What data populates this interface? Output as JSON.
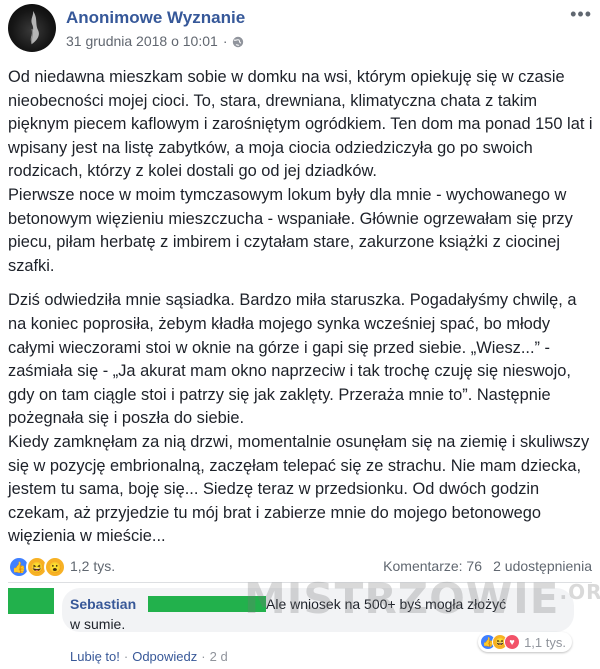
{
  "post": {
    "page_name": "Anonimowe Wyznanie",
    "date": "31 grudnia 2018 o 10:01",
    "separator": "·",
    "more_icon": "more-dots-icon",
    "paragraphs": [
      "Od niedawna mieszkam sobie w domku na wsi, którym opiekuję się w czasie nieobecności mojej cioci. To, stara, drewniana, klimatyczna chata z takim pięknym piecem kaflowym i zarośniętym ogródkiem. Ten dom ma ponad 150 lat i wpisany jest na listę zabytków, a moja ciocia odziedziczyła go po swoich rodzicach, którzy z kolei dostali go od jej dziadków.\nPierwsze noce w moim tymczasowym lokum były dla mnie - wychowanego w betonowym więzieniu mieszczucha - wspaniałe. Głównie ogrzewałam się przy piecu, piłam herbatę z imbirem i czytałam stare, zakurzone książki z ciocinej szafki.",
      "Dziś odwiedziła mnie sąsiadka. Bardzo miła staruszka. Pogadałyśmy chwilę, a na koniec poprosiła, żebym kładła mojego synka wcześniej spać, bo młody całymi wieczorami stoi w oknie na górze i gapi się przed siebie. „Wiesz...” - zaśmiała się - „Ja akurat mam okno naprzeciw i tak trochę czuję się nieswojo, gdy on tam ciągle stoi i patrzy się jak zaklęty. Przeraża mnie to”. Następnie pożegnała się i poszła do siebie.\nKiedy zamknęłam za nią drzwi, momentalnie osunęłam się na ziemię i skuliwszy się w pozycję embrionalną, zaczęłam telepać się ze strachu. Nie mam dziecka, jestem tu sama, boję się... Siedzę teraz w przedsionku. Od dwóch godzin czekam, aż przyjedzie tu mój brat i zabierze mnie do mojego betonowego więzienia w mieście..."
    ],
    "reactions_count": "1,2 tys.",
    "comments_count": "Komentarze: 76",
    "shares_count": "2 udostępnienia",
    "colors": {
      "link": "#365899",
      "accent": "#4080ff",
      "redaction": "#22b14c"
    }
  },
  "comment": {
    "author": "Sebastian",
    "text_line1": "Ale wniosek na 500+ byś mogła złożyć",
    "text_line2": "w sumie.",
    "reactions_count": "1,1 tys.",
    "like_label": "Lubię to!",
    "reply_label": "Odpowiedz",
    "dot": "·",
    "time": "2 d"
  },
  "watermark": {
    "main": "MISTRZOWIE",
    "suffix": ".ORG"
  }
}
